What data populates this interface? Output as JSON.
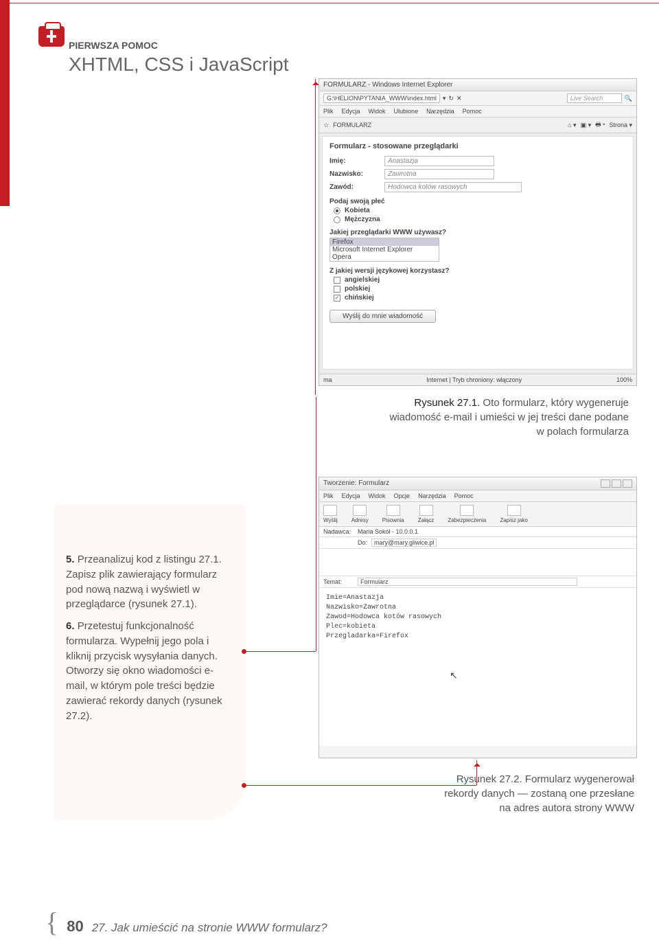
{
  "header": {
    "small": "PIERWSZA POMOC",
    "main": "XHTML, CSS i JavaScript"
  },
  "shot1": {
    "title": "FORMULARZ - Windows Internet Explorer",
    "address": "G:\\HELION\\PYTANIA_WWW\\index.html",
    "search_placeholder": "Live Search",
    "menu": [
      "Plik",
      "Edycja",
      "Widok",
      "Ulubione",
      "Narzędzia",
      "Pomoc"
    ],
    "tab": "FORMULARZ",
    "toolbar_right": "Strona ▾",
    "form_title": "Formularz - stosowane przeglądarki",
    "fields": {
      "imie_label": "Imię:",
      "imie_val": "Anastazja",
      "nazw_label": "Nazwisko:",
      "nazw_val": "Zawrotna",
      "zawod_label": "Zawód:",
      "zawod_val": "Hodowca kotów rasowych"
    },
    "gender_head": "Podaj swoją płeć",
    "gender": [
      "Kobieta",
      "Mężczyzna"
    ],
    "browser_head": "Jakiej przeglądarki WWW używasz?",
    "browsers": [
      "Firefox",
      "Microsoft Internet Explorer",
      "Opera"
    ],
    "lang_head": "Z jakiej wersji językowej korzystasz?",
    "langs": [
      "angielskiej",
      "polskiej",
      "chińskiej"
    ],
    "submit": "Wyślij do mnie wiadomość",
    "status_left": "ma",
    "status_mid": "Internet | Tryb chroniony: włączony",
    "status_zoom": "100%"
  },
  "caption1": {
    "title": "Rysunek 27.1.",
    "text": " Oto formularz, który wygeneruje wiadomość e-mail i umieści w jej treści dane podane w polach formularza"
  },
  "steps": {
    "s5": "Przeanalizuj kod z listingu 27.1. Zapisz plik zawierający formularz pod nową nazwą i wyświetl w przeglądarce (rysunek 27.1).",
    "s6": "Przetestuj funkcjonalność formularza. Wypełnij jego pola i kliknij przycisk wysyłania danych. Otworzy się okno wiadomości e-mail, w którym pole treści będzie zawierać rekordy danych (rysunek 27.2)."
  },
  "shot2": {
    "title": "Tworzenie: Formularz",
    "menu": [
      "Plik",
      "Edycja",
      "Widok",
      "Opcje",
      "Narzędzia",
      "Pomoc"
    ],
    "toolbar": [
      "Wyślij",
      "Adresy",
      "Pisownia",
      "Załącz",
      "Zabezpieczenia",
      "Zapisz jako"
    ],
    "nadawca_label": "Nadawca:",
    "nadawca_val": "Maria Sokół  - 10.0.0.1",
    "do_label": "Do:",
    "do_val": "mary@mary.gliwice.pl",
    "temat_label": "Temat:",
    "temat_val": "Formularz",
    "body_lines": [
      "Imie=Anastazja",
      "Nazwisko=Zawrotna",
      "Zawod=Hodowca kotów rasowych",
      "Plec=kobieta",
      "Przegladarka=Firefox"
    ]
  },
  "caption2": {
    "title": "Rysunek 27.2.",
    "text": " Formularz wygenerował rekordy danych — zostaną one przesłane na adres autora strony WWW"
  },
  "footer": {
    "page": "80",
    "text": "27. Jak umieścić na stronie WWW formularz?"
  }
}
